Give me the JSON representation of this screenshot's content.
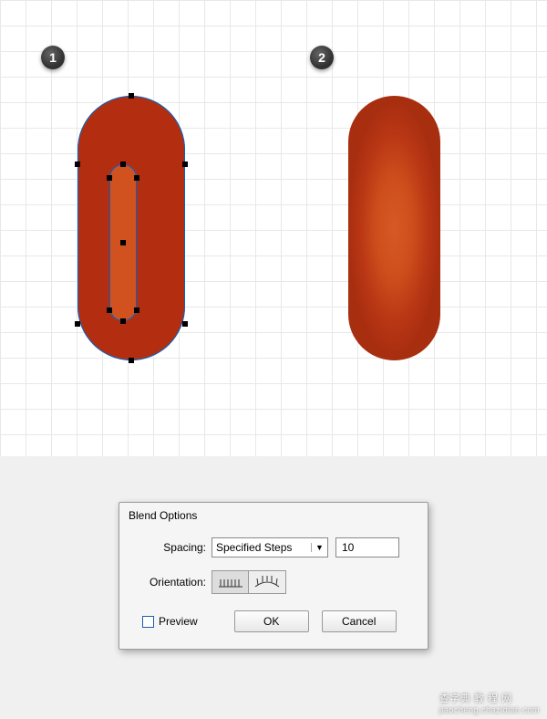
{
  "steps": {
    "one": "1",
    "two": "2"
  },
  "shapes": {
    "outer_fill": "#b32e11",
    "inner_fill": "#d1521f"
  },
  "dialog": {
    "title": "Blend Options",
    "spacing_label": "Spacing:",
    "spacing_value": "Specified Steps",
    "steps_value": "10",
    "orientation_label": "Orientation:",
    "preview_label": "Preview",
    "ok_label": "OK",
    "cancel_label": "Cancel"
  },
  "watermark": {
    "main": "查字典 教 程 网",
    "sub": "jiaocheng.chazidian.com"
  }
}
